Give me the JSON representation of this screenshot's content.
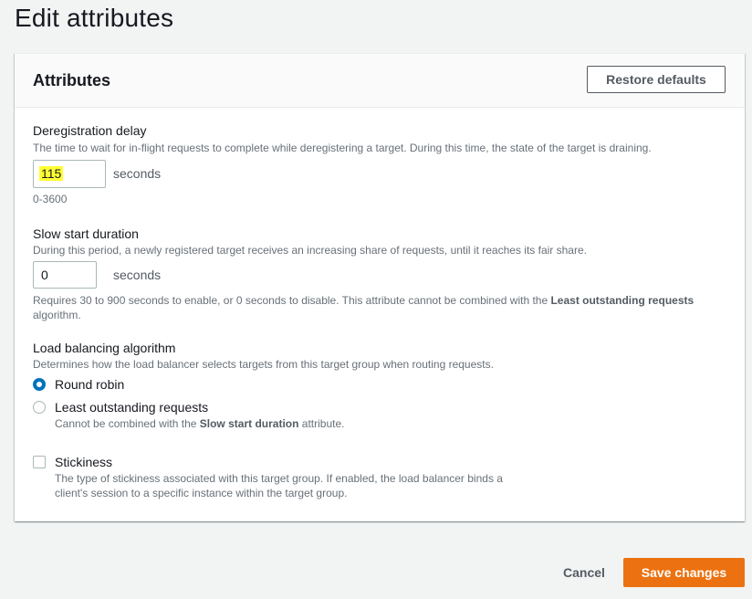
{
  "page": {
    "title": "Edit attributes"
  },
  "panel": {
    "title": "Attributes",
    "restore_label": "Restore defaults"
  },
  "deregistration": {
    "label": "Deregistration delay",
    "description": "The time to wait for in-flight requests to complete while deregistering a target. During this time, the state of the target is draining.",
    "value": "115",
    "unit": "seconds",
    "constraint": "0-3600"
  },
  "slow_start": {
    "label": "Slow start duration",
    "description": "During this period, a newly registered target receives an increasing share of requests, until it reaches its fair share.",
    "value": "0",
    "unit": "seconds",
    "hint_before": "Requires 30 to 900 seconds to enable, or 0 seconds to disable. This attribute cannot be combined with the ",
    "hint_bold": "Least outstanding requests",
    "hint_after": " algorithm."
  },
  "algorithm": {
    "label": "Load balancing algorithm",
    "description": "Determines how the load balancer selects targets from this target group when routing requests.",
    "options": [
      {
        "label": "Round robin",
        "selected": true
      },
      {
        "label": "Least outstanding requests",
        "selected": false,
        "note_before": "Cannot be combined with the ",
        "note_bold": "Slow start duration",
        "note_after": " attribute."
      }
    ]
  },
  "stickiness": {
    "label": "Stickiness",
    "checked": false,
    "description_line1": "The type of stickiness associated with this target group. If enabled, the load balancer binds a",
    "description_line2": "client's session to a specific instance within the target group."
  },
  "footer": {
    "cancel_label": "Cancel",
    "save_label": "Save changes"
  },
  "colors": {
    "primary": "#ec7211",
    "radio_selected": "#0073bb",
    "highlight": "#ffff33"
  }
}
